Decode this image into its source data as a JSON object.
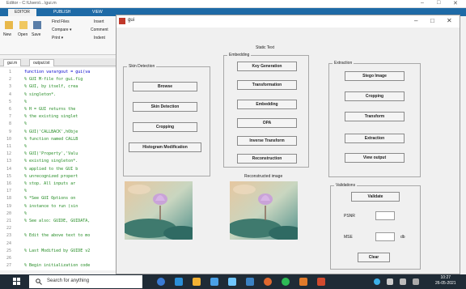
{
  "editor": {
    "title": "Editor - C:\\Users\\...\\gui.m",
    "window_controls": [
      "–",
      "□",
      "✕"
    ],
    "ribbon_tabs": [
      "EDITOR",
      "PUBLISH",
      "VIEW"
    ],
    "ribbon": {
      "new": "New",
      "open": "Open",
      "save": "Save",
      "find_files": "Find Files",
      "compare": "Compare ▾",
      "print": "Print ▾",
      "insert": "Insert",
      "comment": "Comment",
      "indent": "Indent"
    },
    "file_tabs": [
      "gui.m",
      "output.txt"
    ],
    "code_lines": [
      {
        "n": "1",
        "text": "function varargout = gui(va",
        "kw": true
      },
      {
        "n": "2",
        "text": "% GUI M-file for gui.fig",
        "kw": false
      },
      {
        "n": "3",
        "text": "%      GUI, by itself, crea",
        "kw": false
      },
      {
        "n": "4",
        "text": "%      singleton*.",
        "kw": false
      },
      {
        "n": "5",
        "text": "%",
        "kw": false
      },
      {
        "n": "6",
        "text": "%      H = GUI returns the",
        "kw": false
      },
      {
        "n": "7",
        "text": "%      the existing singlet",
        "kw": false
      },
      {
        "n": "8",
        "text": "%",
        "kw": false
      },
      {
        "n": "9",
        "text": "%      GUI('CALLBACK',hObje",
        "kw": false
      },
      {
        "n": "10",
        "text": "%      function named CALLB",
        "kw": false
      },
      {
        "n": "11",
        "text": "%",
        "kw": false
      },
      {
        "n": "12",
        "text": "%      GUI('Property','Valu",
        "kw": false
      },
      {
        "n": "13",
        "text": "%      existing singleton*.",
        "kw": false
      },
      {
        "n": "14",
        "text": "%      applied to the GUI b",
        "kw": false
      },
      {
        "n": "15",
        "text": "%      unrecognized propert",
        "kw": false
      },
      {
        "n": "16",
        "text": "%      stop.  All inputs ar",
        "kw": false
      },
      {
        "n": "17",
        "text": "%",
        "kw": false
      },
      {
        "n": "18",
        "text": "%      *See GUI Options on",
        "kw": false
      },
      {
        "n": "19",
        "text": "%      instance to run (sin",
        "kw": false
      },
      {
        "n": "20",
        "text": "%",
        "kw": false
      },
      {
        "n": "21",
        "text": "% See also: GUIDE, GUIDATA,",
        "kw": false
      },
      {
        "n": "22",
        "text": "",
        "kw": false
      },
      {
        "n": "23",
        "text": "% Edit the above text to mo",
        "kw": false
      },
      {
        "n": "24",
        "text": "",
        "kw": false
      },
      {
        "n": "25",
        "text": "% Last Modified by GUIDE v2",
        "kw": false
      },
      {
        "n": "26",
        "text": "",
        "kw": false
      },
      {
        "n": "27",
        "text": "% Begin initialization code",
        "kw": false
      }
    ]
  },
  "gui": {
    "title": "gui",
    "window_controls": [
      "–",
      "□",
      "✕"
    ],
    "static_text": "Static Text",
    "skin_detection": {
      "label": "Skin Detection",
      "buttons": [
        "Browse",
        "Skin Detection",
        "Cropping",
        "Histogram Modification"
      ]
    },
    "embedding": {
      "label": "Embedding",
      "buttons": [
        "Key Generation",
        "Transformation",
        "Embedding",
        "OPA",
        "Inverse Transform",
        "Reconstruction"
      ]
    },
    "extraction": {
      "label": "Extraction",
      "buttons": [
        "Stego Image",
        "Cropping",
        "Transform",
        "Extraction",
        "View output"
      ]
    },
    "reconstructed_label": "Reconstructed image",
    "validations": {
      "label": "Validations",
      "validate": "Validate",
      "psnr_label": "PSNR",
      "mse_label": "MSE",
      "db_label": "db",
      "clear": "Clear",
      "psnr_value": "",
      "mse_value": ""
    }
  },
  "taskbar": {
    "search_placeholder": "Search for anything",
    "time": "10:27",
    "date": "26-05-2021"
  }
}
